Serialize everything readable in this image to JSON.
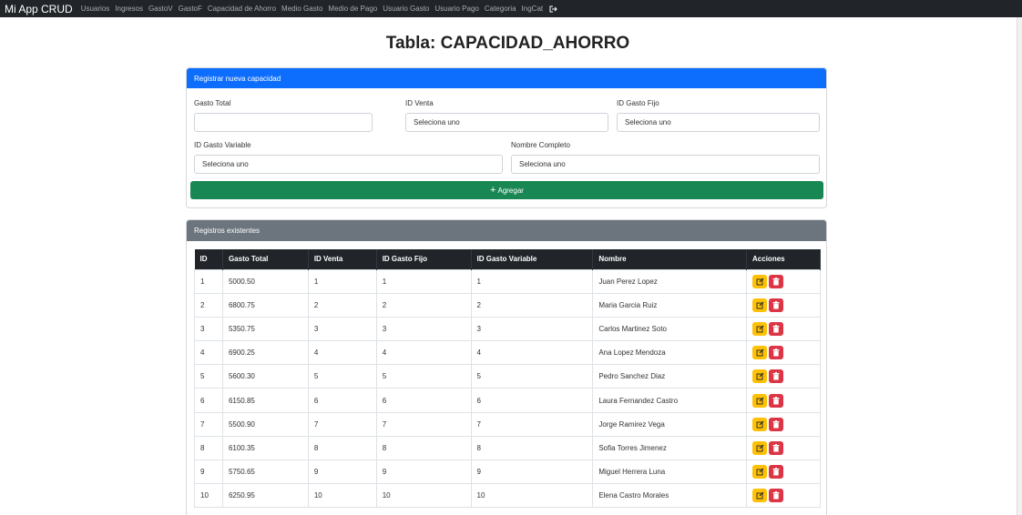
{
  "navbar": {
    "brand": "Mi App CRUD",
    "links": [
      "Usuarios",
      "Ingresos",
      "GastoV",
      "GastoF",
      "Capacidad de Ahorro",
      "Medio Gasto",
      "Medio de Pago",
      "Usuario Gasto",
      "Usuario Pago",
      "Categoria",
      "IngCat"
    ],
    "logout_icon": "logout-icon"
  },
  "page": {
    "title": "Tabla: CAPACIDAD_AHORRO"
  },
  "form": {
    "header": "Registrar nueva capacidad",
    "gasto_total_label": "Gasto Total",
    "gasto_total_value": "",
    "id_venta_label": "ID Venta",
    "id_venta_value": "Seleciona uno",
    "id_gasto_fijo_label": "ID Gasto Fijo",
    "id_gasto_fijo_value": "Seleciona uno",
    "id_gasto_variable_label": "ID Gasto Variable",
    "id_gasto_variable_value": "Seleciona uno",
    "nombre_completo_label": "Nombre Completo",
    "nombre_completo_value": "Seleciona uno",
    "add_button": "Agregar",
    "add_icon": "plus-icon"
  },
  "records": {
    "header": "Registros existentes",
    "columns": [
      "ID",
      "Gasto Total",
      "ID Venta",
      "ID Gasto Fijo",
      "ID Gasto Variable",
      "Nombre",
      "Acciones"
    ],
    "rows": [
      [
        "1",
        "5000.50",
        "1",
        "1",
        "1",
        "Juan Perez Lopez"
      ],
      [
        "2",
        "6800.75",
        "2",
        "2",
        "2",
        "Maria Garcia Ruiz"
      ],
      [
        "3",
        "5350.75",
        "3",
        "3",
        "3",
        "Carlos Martinez Soto"
      ],
      [
        "4",
        "6900.25",
        "4",
        "4",
        "4",
        "Ana Lopez Mendoza"
      ],
      [
        "5",
        "5600.30",
        "5",
        "5",
        "5",
        "Pedro Sanchez Diaz"
      ],
      [
        "6",
        "6150.85",
        "6",
        "6",
        "6",
        "Laura Fernandez Castro"
      ],
      [
        "7",
        "5500.90",
        "7",
        "7",
        "7",
        "Jorge Ramirez Vega"
      ],
      [
        "8",
        "6100.35",
        "8",
        "8",
        "8",
        "Sofia Torres Jimenez"
      ],
      [
        "9",
        "5750.65",
        "9",
        "9",
        "9",
        "Miguel Herrera Luna"
      ],
      [
        "10",
        "6250.95",
        "10",
        "10",
        "10",
        "Elena Castro Morales"
      ]
    ],
    "edit_icon": "edit-icon",
    "delete_icon": "trash-icon"
  },
  "colors": {
    "navbar": "#212529",
    "primary": "#0d6efd",
    "secondary": "#6c757d",
    "success": "#198754",
    "warning": "#ffc107",
    "danger": "#dc3545"
  }
}
